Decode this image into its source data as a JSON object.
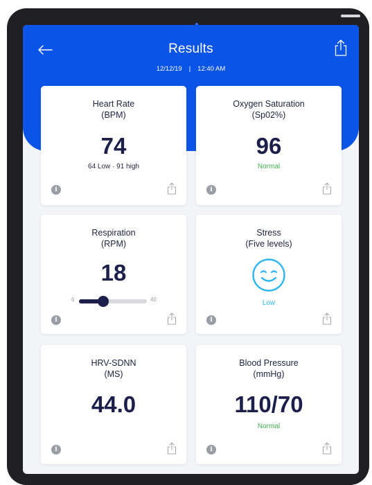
{
  "header": {
    "title": "Results",
    "date": "12/12/19",
    "separator": "|",
    "time": "12:40 AM"
  },
  "colors": {
    "primary": "#0a55e8",
    "value_text": "#1c1f4a",
    "normal": "#3cae4b",
    "low": "#2fb5f0",
    "info": "#9a9da3"
  },
  "icons": {
    "back": "arrow-left-icon",
    "share": "share-icon",
    "info": "info-icon",
    "stress": "smiley-icon"
  },
  "cards": {
    "heart_rate": {
      "title1": "Heart Rate",
      "title2": "(BPM)",
      "value": "74",
      "sub": "64 Low · 91 high"
    },
    "oxygen": {
      "title1": "Oxygen Saturation",
      "title2": "(Sp02%)",
      "value": "96",
      "sub": "Normal"
    },
    "respiration": {
      "title1": "Respiration",
      "title2": "(RPM)",
      "value": "18",
      "slider_min": "6",
      "slider_max": "40",
      "slider_value": 18
    },
    "stress": {
      "title1": "Stress",
      "title2": "(Five levels)",
      "sub": "Low"
    },
    "hrv": {
      "title1": "HRV-SDNN",
      "title2": "(MS)",
      "value": "44.0"
    },
    "blood_pressure": {
      "title1": "Blood Pressure",
      "title2": "(mmHg)",
      "value": "110/70",
      "sub": "Normal"
    }
  },
  "info_glyph": "i"
}
